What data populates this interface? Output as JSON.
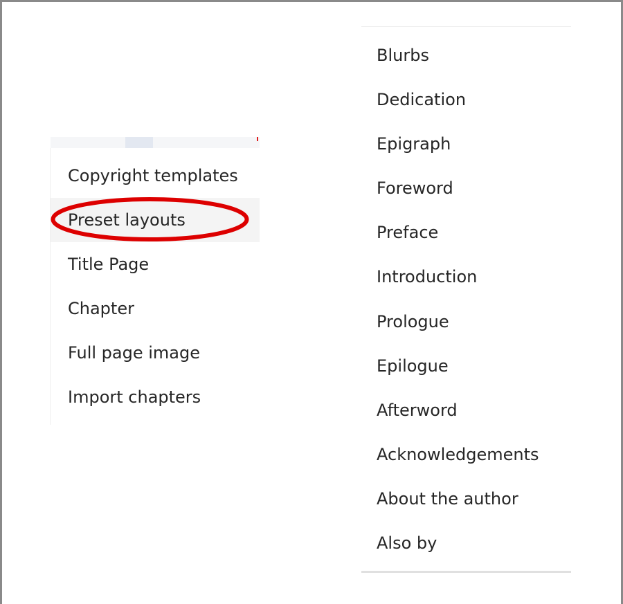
{
  "left_menu": {
    "items": [
      {
        "label": "Copyright templates"
      },
      {
        "label": "Preset layouts",
        "highlighted": true
      },
      {
        "label": "Title Page"
      },
      {
        "label": "Chapter"
      },
      {
        "label": "Full page image"
      },
      {
        "label": "Import chapters"
      }
    ]
  },
  "right_menu": {
    "items": [
      {
        "label": "Blurbs"
      },
      {
        "label": "Dedication"
      },
      {
        "label": "Epigraph"
      },
      {
        "label": "Foreword"
      },
      {
        "label": "Preface"
      },
      {
        "label": "Introduction"
      },
      {
        "label": "Prologue"
      },
      {
        "label": "Epilogue"
      },
      {
        "label": "Afterword"
      },
      {
        "label": "Acknowledgements"
      },
      {
        "label": "About the author"
      },
      {
        "label": "Also by"
      }
    ]
  },
  "colors": {
    "annotation": "#dd0000",
    "text": "#262626",
    "highlight_bg": "#f4f4f4"
  }
}
